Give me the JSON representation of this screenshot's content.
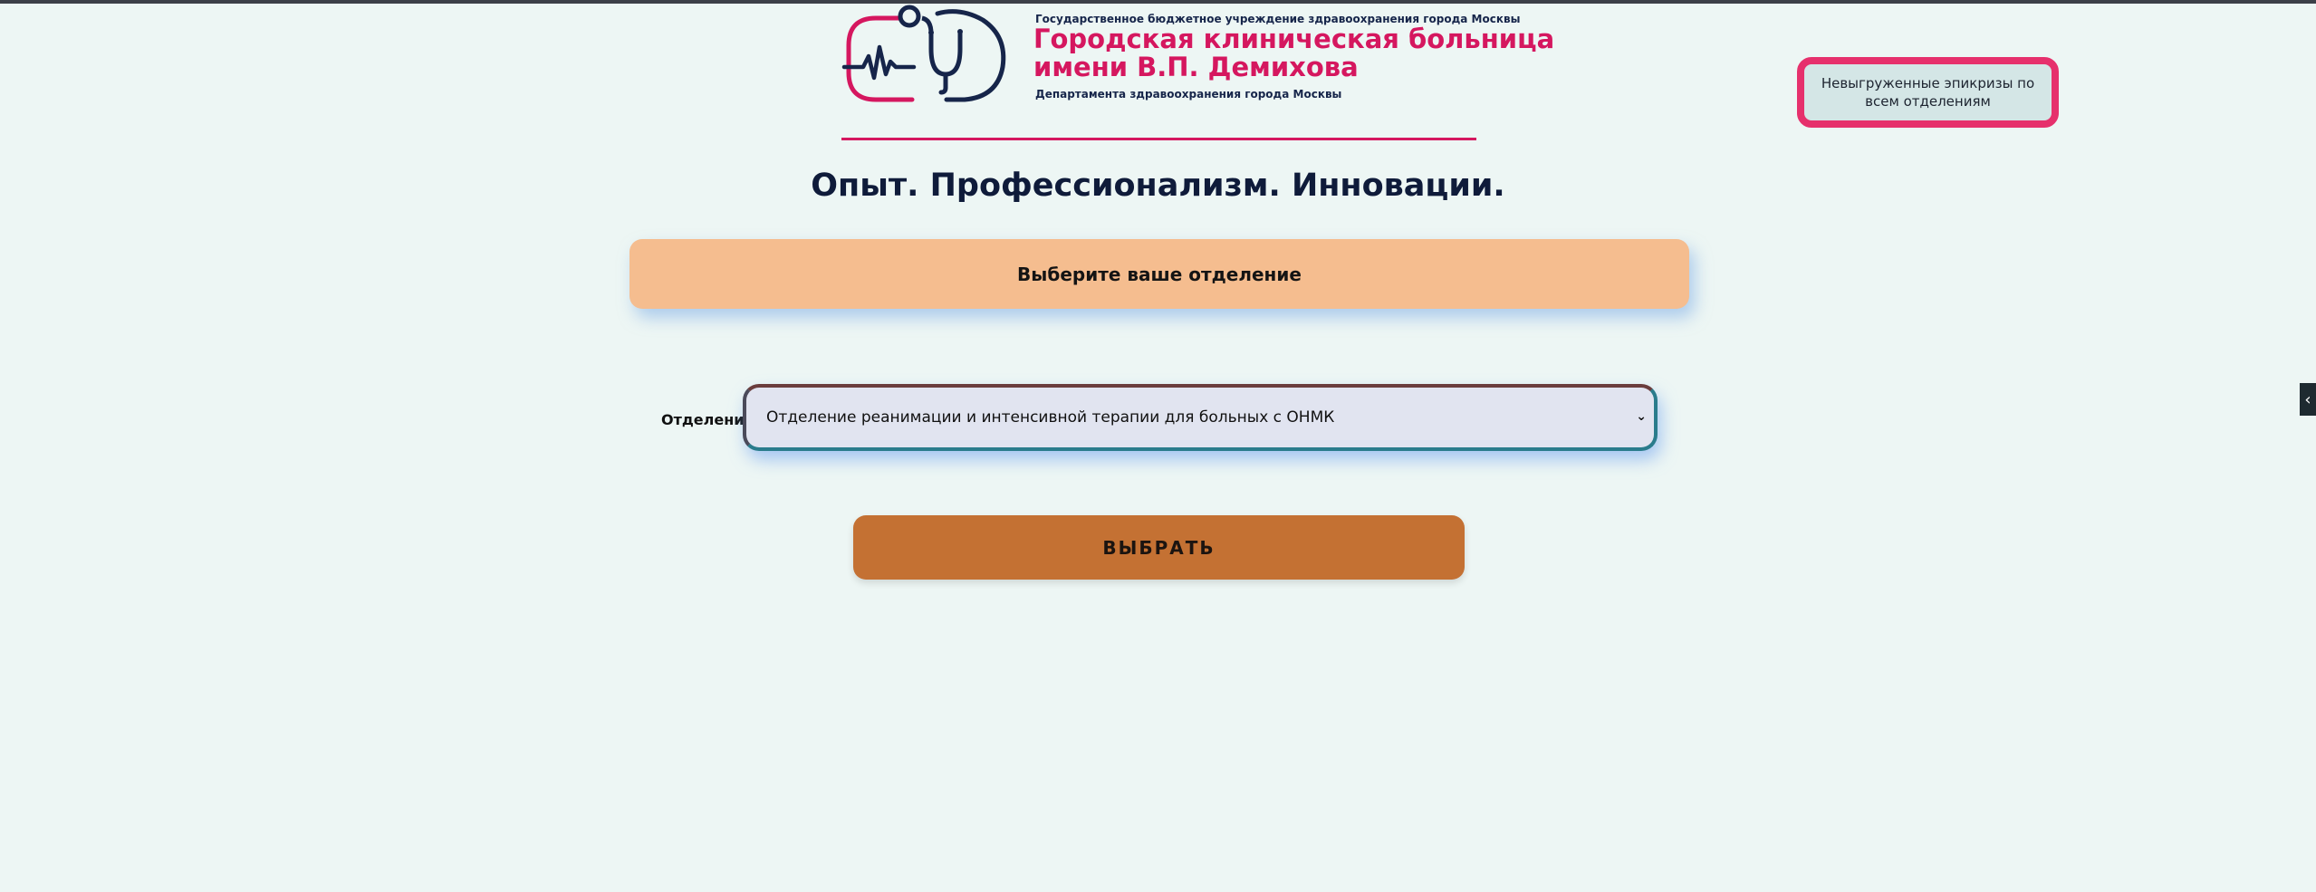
{
  "header": {
    "org_top": "Государственное бюджетное учреждение здравоохранения города Москвы",
    "org_name_line1": "Городская клиническая больница",
    "org_name_line2": "имени В.П. Демихова",
    "org_bottom": "Департамента здравоохранения города Москвы",
    "logo_icon": "stethoscope-heartbeat-icon",
    "brand_color": "#d5175f",
    "navy_color": "#16254a"
  },
  "slogan": "Опыт. Профессионализм. Инновации.",
  "unloaded_button": {
    "label": "Невыгруженные эпикризы по всем отделениям",
    "border_color": "#e6306c"
  },
  "panel_title": "Выберите ваше отделение",
  "department": {
    "label": "Отделение:",
    "selected": "Отделение реанимации и интенсивной терапии для больных с ОНМК"
  },
  "submit_button": {
    "label": "ВЫБРАТЬ",
    "color": "#c47133"
  },
  "side_tab": {
    "icon": "chevron-left-icon",
    "glyph": "‹"
  }
}
